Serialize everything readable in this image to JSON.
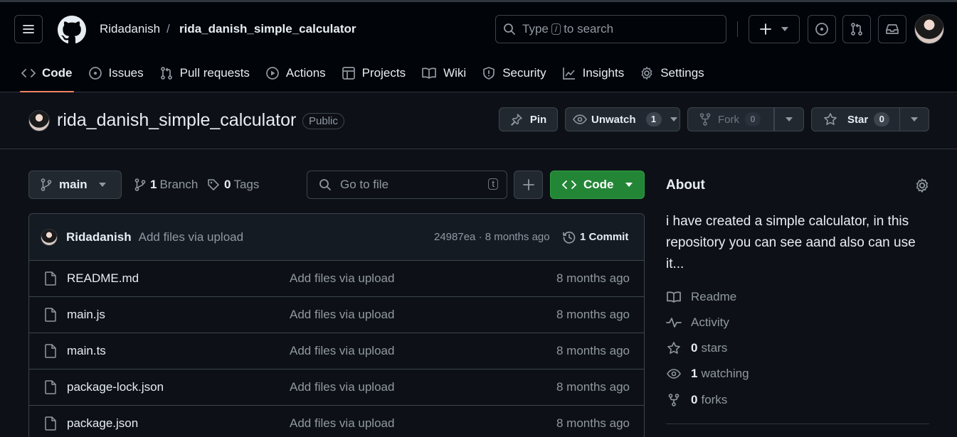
{
  "header": {
    "owner": "Ridadanish",
    "separator": "/",
    "repo": "rida_danish_simple_calculator",
    "search": {
      "before": "Type",
      "key": "/",
      "after": "to search"
    }
  },
  "tabs": [
    {
      "label": "Code",
      "icon": "code-icon",
      "active": true
    },
    {
      "label": "Issues",
      "icon": "issue-icon"
    },
    {
      "label": "Pull requests",
      "icon": "pull-request-icon"
    },
    {
      "label": "Actions",
      "icon": "play-icon"
    },
    {
      "label": "Projects",
      "icon": "table-icon"
    },
    {
      "label": "Wiki",
      "icon": "book-icon"
    },
    {
      "label": "Security",
      "icon": "shield-icon"
    },
    {
      "label": "Insights",
      "icon": "graph-icon"
    },
    {
      "label": "Settings",
      "icon": "gear-icon"
    }
  ],
  "repo_header": {
    "name": "rida_danish_simple_calculator",
    "visibility": "Public",
    "pin": "Pin",
    "unwatch": "Unwatch",
    "watch_count": "1",
    "fork": "Fork",
    "fork_count": "0",
    "star": "Star",
    "star_count": "0"
  },
  "toolbar": {
    "branch": "main",
    "branches_count": "1",
    "branches_label": "Branch",
    "tags_count": "0",
    "tags_label": "Tags",
    "goto_placeholder": "Go to file",
    "goto_key": "t",
    "code_button": "Code"
  },
  "commit": {
    "author": "Ridadanish",
    "message": "Add files via upload",
    "meta": "24987ea · 8 months ago",
    "commits_count": "1",
    "commits_label": "Commit"
  },
  "files": [
    {
      "name": "README.md",
      "message": "Add files via upload",
      "date": "8 months ago"
    },
    {
      "name": "main.js",
      "message": "Add files via upload",
      "date": "8 months ago"
    },
    {
      "name": "main.ts",
      "message": "Add files via upload",
      "date": "8 months ago"
    },
    {
      "name": "package-lock.json",
      "message": "Add files via upload",
      "date": "8 months ago"
    },
    {
      "name": "package.json",
      "message": "Add files via upload",
      "date": "8 months ago"
    }
  ],
  "about": {
    "title": "About",
    "description": "i have created a simple calculator, in this repository you can see aand also can use it...",
    "readme": "Readme",
    "activity": "Activity",
    "stars_count": "0",
    "stars_label": "stars",
    "watching_count": "1",
    "watching_label": "watching",
    "forks_count": "0",
    "forks_label": "forks"
  },
  "colors": {
    "background": "#0d1117",
    "header": "#010409",
    "border": "#3d444d",
    "accent_tab": "#f78166",
    "code_button": "#238636"
  }
}
